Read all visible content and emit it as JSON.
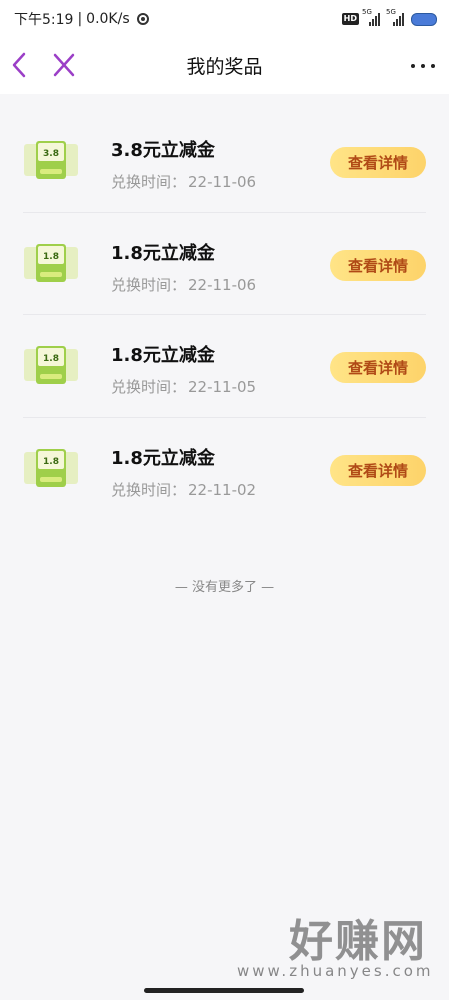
{
  "status_bar": {
    "time": "下午5:19",
    "separator": "|",
    "speed": "0.0K/s",
    "hd": "HD",
    "net1": "5G",
    "net2": "5G"
  },
  "header": {
    "title": "我的奖品"
  },
  "prizes": [
    {
      "thumb_value": "3.8",
      "name": "3.8元立减金",
      "date_label": "兑换时间：",
      "date": "22-11-06",
      "button": "查看详情"
    },
    {
      "thumb_value": "1.8",
      "name": "1.8元立减金",
      "date_label": "兑换时间：",
      "date": "22-11-06",
      "button": "查看详情"
    },
    {
      "thumb_value": "1.8",
      "name": "1.8元立减金",
      "date_label": "兑换时间：",
      "date": "22-11-05",
      "button": "查看详情"
    },
    {
      "thumb_value": "1.8",
      "name": "1.8元立减金",
      "date_label": "兑换时间：",
      "date": "22-11-02",
      "button": "查看详情"
    }
  ],
  "footer": {
    "end_text": "— 没有更多了 —"
  },
  "watermark": {
    "main": "好赚网",
    "domain": "www.zhuanyes.com"
  },
  "colors": {
    "accent_purple": "#9b3fc7",
    "button_gradient_start": "#ffe487",
    "button_gradient_end": "#fdd36a",
    "button_text": "#b04a16"
  }
}
